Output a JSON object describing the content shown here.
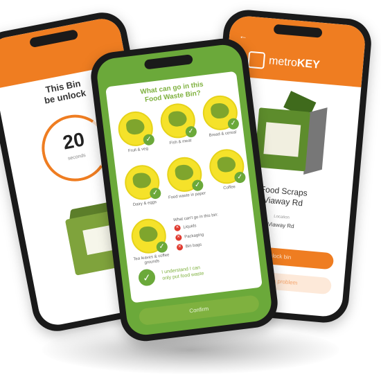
{
  "colors": {
    "orange": "#ef7d21",
    "green": "#6ba93a",
    "yellow": "#f5e22a",
    "red": "#e03a2f"
  },
  "phone_left": {
    "title_line1": "This Bin",
    "title_line2": "be unlock",
    "countdown": "20",
    "countdown_label": "seconds"
  },
  "phone_mid": {
    "question_line1": "What can go in this",
    "question_line2": "Food Waste Bin?",
    "items": [
      {
        "label": "Fruit & veg",
        "icon": "fruit-icon"
      },
      {
        "label": "Fish & meat",
        "icon": "fish-icon"
      },
      {
        "label": "Bread & cereal",
        "icon": "bread-icon"
      },
      {
        "label": "Dairy & eggs",
        "icon": "dairy-icon"
      },
      {
        "label": "Food waste in paper",
        "icon": "paper-bag-icon"
      },
      {
        "label": "Coffee",
        "icon": "coffee-icon"
      },
      {
        "label": "Tea leaves & coffee grounds",
        "icon": "plant-icon"
      }
    ],
    "not_allowed_heading": "What can't go in this bin:",
    "not_allowed": [
      "Liquids",
      "Packaging",
      "Bin bags"
    ],
    "confirm_line1": "I understand I can",
    "confirm_line2": "only put food waste",
    "cta": "Confirm"
  },
  "phone_right": {
    "back": "←",
    "brand_light": "metro",
    "brand_bold": "KEY",
    "bin_name_line1": "Food Scraps",
    "bin_name_line2": "Viaway Rd",
    "location_label": "Location",
    "location_value": "Viaway Rd",
    "unlock_button": "Unlock bin",
    "report_button": "Report a problem"
  }
}
